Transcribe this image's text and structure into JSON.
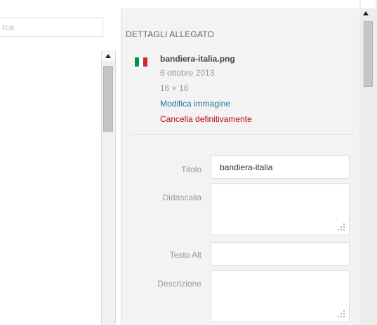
{
  "search": {
    "value": "rca",
    "placeholder": ""
  },
  "details": {
    "title": "DETTAGLI ALLEGATO",
    "file_name": "bandiera-italia.png",
    "date": "6 ottobre 2013",
    "dimensions": "16 × 16",
    "edit_link": "Modifica immagine",
    "delete_link": "Cancella definitivamente",
    "flag_colors": [
      "#009246",
      "#ffffff",
      "#ce2b37"
    ]
  },
  "form": {
    "title_label": "Titolo",
    "title_value": "bandiera-italia",
    "caption_label": "Didascalia",
    "caption_value": "",
    "alt_label": "Testo Alt",
    "alt_value": "",
    "description_label": "Descrizione",
    "description_value": ""
  },
  "colors": {
    "link": "#21759b",
    "delete": "#bc0b0b",
    "panel_bg": "#f3f3f3"
  }
}
